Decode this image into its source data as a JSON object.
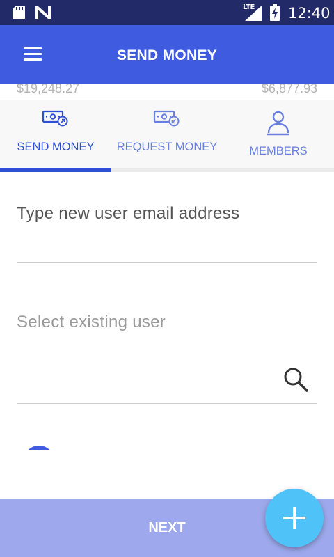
{
  "status_bar": {
    "network": "LTE",
    "time": "12:40"
  },
  "app_bar": {
    "title": "SEND MONEY",
    "menu_icon": "hamburger-menu-icon"
  },
  "balances": {
    "left": "$19,248.27",
    "right": "$6,877.93"
  },
  "tabs": [
    {
      "label": "SEND MONEY",
      "icon": "send-money-icon",
      "active": true
    },
    {
      "label": "REQUEST MONEY",
      "icon": "request-money-icon",
      "active": false
    },
    {
      "label": "MEMBERS",
      "icon": "members-icon",
      "active": false
    }
  ],
  "form": {
    "email_placeholder": "Type new user email address",
    "select_label": "Select existing user",
    "search_icon": "search-icon"
  },
  "footer": {
    "next_label": "NEXT",
    "fab_icon": "plus-icon"
  },
  "colors": {
    "status_bar": "#222b68",
    "app_bar": "#3f5ce0",
    "active_tab": "#2f4fd4",
    "inactive_tab": "#6a80e0",
    "next_button": "#9da9ec",
    "fab": "#4fc3f7"
  }
}
